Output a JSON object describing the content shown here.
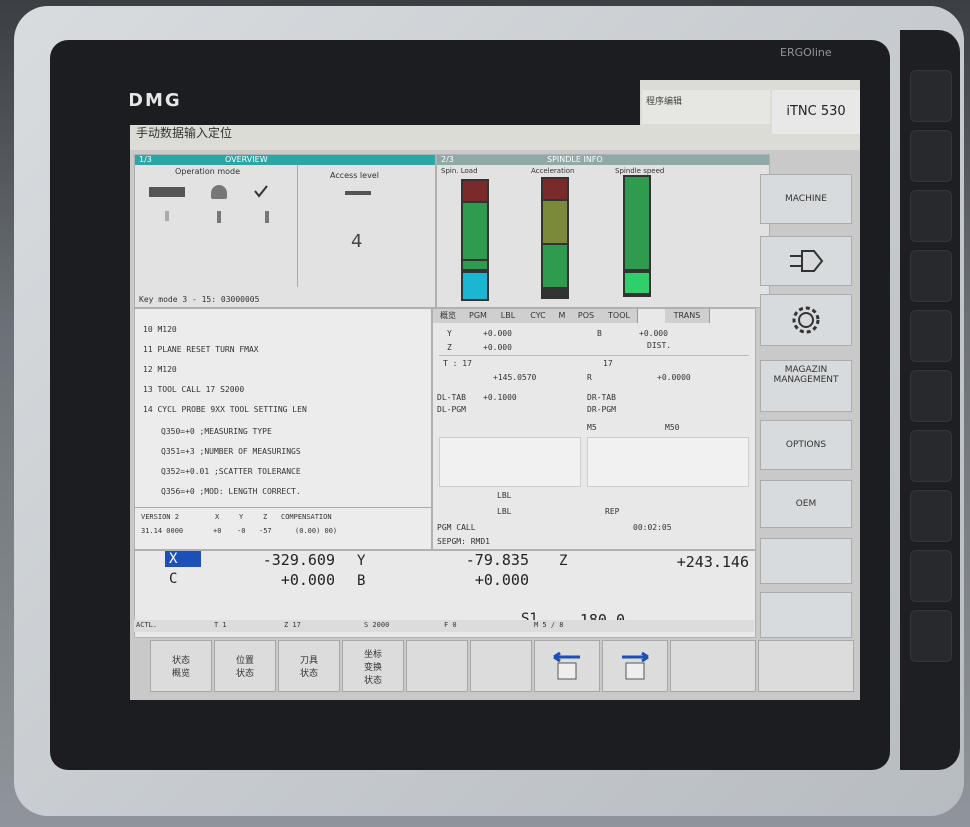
{
  "device": {
    "brand": "DMG",
    "bezel_brand": "ERGOline",
    "control": "iTNC 530"
  },
  "header": {
    "mode_title": "手动数据输入定位",
    "program_edit": "程序编辑"
  },
  "overview": {
    "tab_num": "1/3",
    "tab_title": "OVERVIEW",
    "operation_mode": "Operation mode",
    "access_level_label": "Access level",
    "access_level": "4",
    "key_mode": "Key mode 3 - 15: 03000005"
  },
  "spindle": {
    "tab_num": "2/3",
    "title": "SPINDLE INFO",
    "cols": [
      "Spin. Load",
      "Acceleration",
      "Spindle speed"
    ]
  },
  "program": {
    "lines": [
      "10 M120",
      "11 PLANE RESET TURN FMAX",
      "12 M120",
      "13 TOOL CALL 17 S2000",
      "14 CYCL PROBE 9XX TOOL SETTING LEN",
      "Q350=+0 ;MEASURING TYPE",
      "Q351=+3 ;NUMBER OF MEASURINGS",
      "Q352=+0.01 ;SCATTER TOLERANCE",
      "Q356=+0 ;MOD: LENGTH CORRECT."
    ],
    "version_row": [
      "VERSION 2",
      "X",
      "Y",
      "Z",
      "COMPENSATION"
    ],
    "status_row": [
      "31.14 0000",
      "+0",
      "-0",
      "-57",
      "(0.00) 00)"
    ]
  },
  "status_tabs": [
    "概览",
    "PGM",
    "LBL",
    "CYC",
    "M",
    "POS",
    "TOOL",
    "TRANS"
  ],
  "status_panel": {
    "y_label": "Y",
    "y_val": "+0.000",
    "b_label": "B",
    "b_val": "+0.000",
    "z_label": "Z",
    "z_val": "+0.000",
    "dist": "DIST.",
    "t_label": "T : 17",
    "t_num": "17",
    "l_val": "+145.0570",
    "r_label": "R",
    "r_val": "+0.0000",
    "dl_tab": "DL-TAB",
    "dl_tab_val": "+0.1000",
    "dr_tab": "DR-TAB",
    "dl_pgm": "DL-PGM",
    "dr_pgm": "DR-PGM",
    "m5": "M5",
    "m50": "M50",
    "lbl1": "LBL",
    "lbl2": "LBL",
    "rep": "REP",
    "pgm_call": "PGM CALL",
    "time": "00:02:05",
    "sepgm": "SEPGM: RMD1"
  },
  "positions": {
    "x_label": "X",
    "x_val": "-329.609",
    "y_label": "Y",
    "y_val": "-79.835",
    "z_label": "Z",
    "z_val": "+243.146",
    "c_label": "C",
    "c_val": "+0.000",
    "b_label": "B",
    "b_val": "+0.000"
  },
  "spindle_status": {
    "s_label": "S1",
    "s_val": "180.0",
    "row": [
      "ACTL.",
      "T 1",
      "Z 17",
      "S 2000",
      "F 0",
      "M 5 / 8"
    ]
  },
  "softkeys": [
    {
      "line1": "状态",
      "line2": "概览"
    },
    {
      "line1": "位置",
      "line2": "状态"
    },
    {
      "line1": "刀具",
      "line2": "状态"
    },
    {
      "line1": "坐标",
      "line2": "变换",
      "line3": "状态"
    }
  ],
  "vertical_softkeys": [
    "MACHINE",
    "MAGAZIN MANAGEMENT",
    "OPTIONS",
    "OEM"
  ],
  "icons": [
    "plug-icon",
    "gear-icon",
    "arrow-left-doc-icon",
    "arrow-right-doc-icon",
    "check-icon"
  ]
}
